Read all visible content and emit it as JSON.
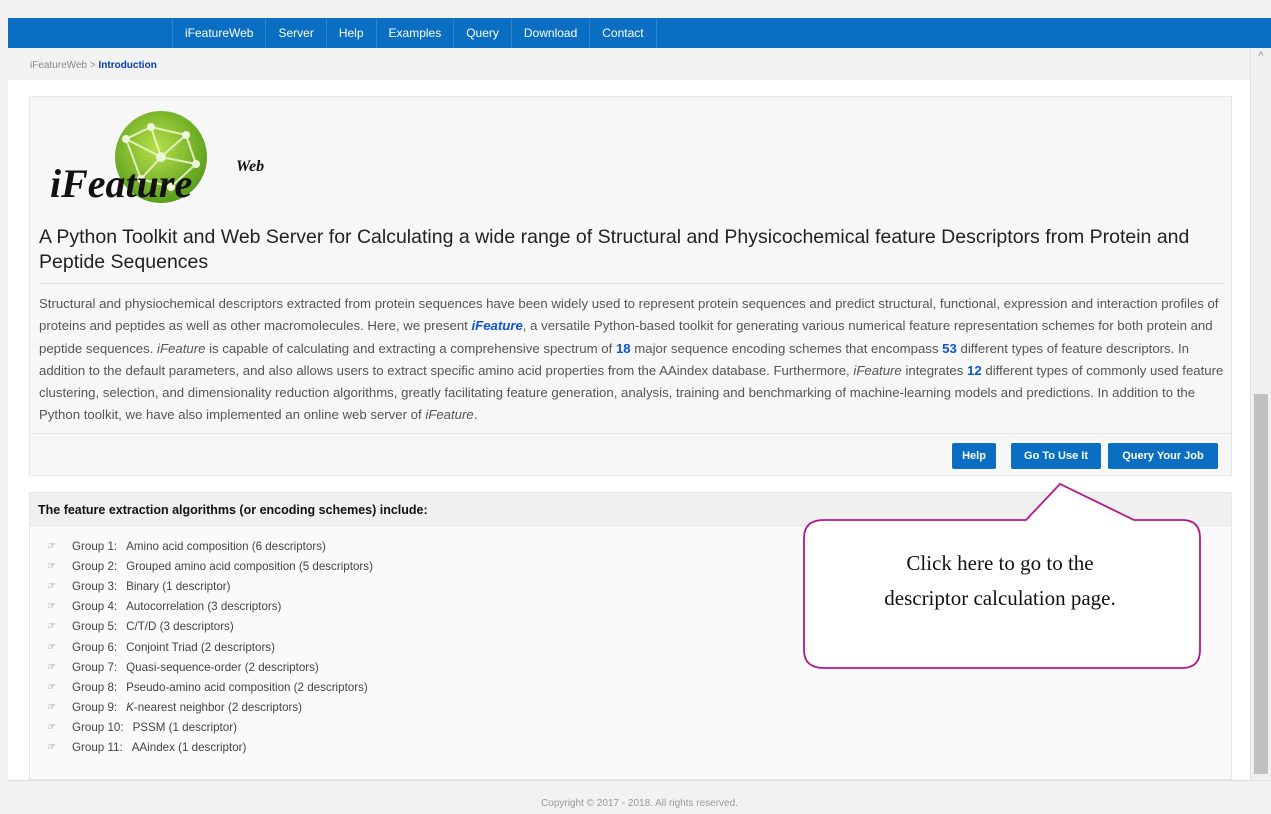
{
  "nav": {
    "items": [
      "iFeatureWeb",
      "Server",
      "Help",
      "Examples",
      "Query",
      "Download",
      "Contact"
    ]
  },
  "breadcrumb": {
    "root": "iFeatureWeb",
    "separator": " > ",
    "current": "Introduction"
  },
  "logo": {
    "brand_text": "iFeature",
    "superscript": "Web"
  },
  "intro": {
    "title": "A Python Toolkit and Web Server for Calculating a wide range of Structural and Physicochemical feature Descriptors from Protein and Peptide Sequences",
    "desc": {
      "p1": "Structural and physiochemical descriptors extracted from protein sequences have been widely used to represent protein sequences and predict structural, functional, expression and interaction profiles of proteins and peptides as well as other macromolecules. Here, we present ",
      "brand1": "iFeature",
      "p2": ", a versatile Python-based toolkit for generating various numerical feature representation schemes for both protein and peptide sequences. ",
      "brand2": "iFeature",
      "p3": " is capable of calculating and extracting a comprehensive spectrum of ",
      "num1": "18",
      "p4": " major sequence encoding schemes that encompass ",
      "num2": "53",
      "p5": " different types of feature descriptors. In addition to the default parameters, and also allows users to extract specific amino acid properties from the AAindex database. Furthermore, ",
      "brand3": "iFeature",
      "p6": " integrates ",
      "num3": "12",
      "p7": " different types of commonly used feature clustering, selection, and dimensionality reduction algorithms, greatly facilitating feature generation, analysis, training and benchmarking of machine-learning models and predictions. In addition to the Python toolkit, we have also implemented an online web server of ",
      "brand4": "iFeature",
      "p8": "."
    }
  },
  "buttons": {
    "help": "Help",
    "go": "Go To Use It",
    "query": "Query Your Job"
  },
  "features": {
    "title": "The feature extraction algorithms (or encoding schemes) include:",
    "icon": "hand-pointer-icon",
    "items": [
      {
        "group": "Group 1:",
        "label": "Amino acid composition (6 descriptors)"
      },
      {
        "group": "Group 2:",
        "label": "Grouped amino acid composition (5 descriptors)"
      },
      {
        "group": "Group 3:",
        "label": "Binary (1 descriptor)"
      },
      {
        "group": "Group 4:",
        "label": "Autocorrelation (3 descriptors)"
      },
      {
        "group": "Group 5:",
        "label": "C/T/D (3 descriptors)"
      },
      {
        "group": "Group 6:",
        "label": "Conjoint Triad (2 descriptors)"
      },
      {
        "group": "Group 7:",
        "label": "Quasi-sequence-order (2 descriptors)"
      },
      {
        "group": "Group 8:",
        "label": "Pseudo-amino acid composition (2 descriptors)"
      },
      {
        "group": "Group 9:",
        "label_italic": "K",
        "label": "-nearest neighbor (2 descriptors)"
      },
      {
        "group": "Group 10:",
        "label": "PSSM (1 descriptor)"
      },
      {
        "group": "Group 11:",
        "label": "AAindex (1 descriptor)"
      }
    ]
  },
  "callout": {
    "line1": "Click here to go to the",
    "line2": "descriptor calculation page."
  },
  "footer": {
    "text": "Copyright © 2017 - 2018. All rights reserved."
  },
  "colors": {
    "nav_bg": "#0a6fc2",
    "accent": "#0a55d6",
    "callout_border": "#b0188c"
  }
}
